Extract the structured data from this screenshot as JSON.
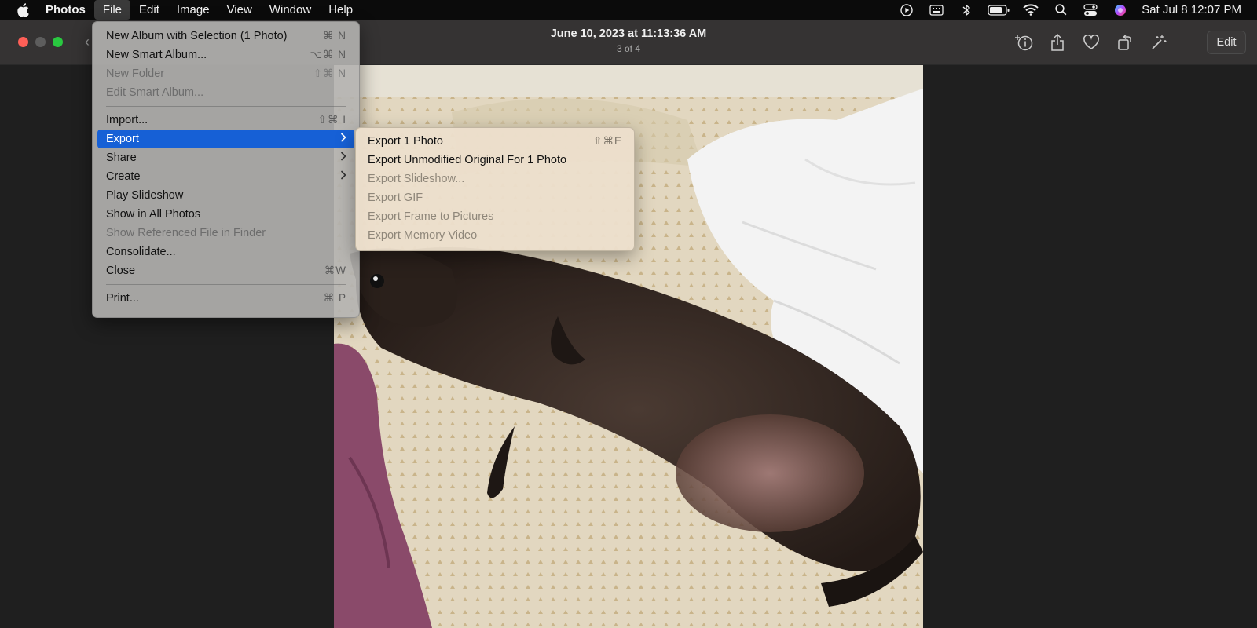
{
  "menubar": {
    "app_name": "Photos",
    "items": [
      "File",
      "Edit",
      "Image",
      "View",
      "Window",
      "Help"
    ],
    "clock": "Sat Jul 8  12:07 PM"
  },
  "toolbar": {
    "title": "June 10, 2023 at 11:13:36 AM",
    "subtitle": "3 of 4",
    "edit_label": "Edit"
  },
  "file_menu": {
    "items": [
      {
        "label": "New Album with Selection (1 Photo)",
        "shortcut": "⌘ N"
      },
      {
        "label": "New Smart Album...",
        "shortcut": "⌥⌘ N"
      },
      {
        "label": "New Folder",
        "shortcut": "⇧⌘ N"
      },
      {
        "label": "Edit Smart Album...",
        "shortcut": ""
      },
      {
        "label": "Import...",
        "shortcut": "⇧⌘ I"
      },
      {
        "label": "Export",
        "shortcut": ""
      },
      {
        "label": "Share",
        "shortcut": ""
      },
      {
        "label": "Create",
        "shortcut": ""
      },
      {
        "label": "Play Slideshow",
        "shortcut": ""
      },
      {
        "label": "Show in All Photos",
        "shortcut": ""
      },
      {
        "label": "Show Referenced File in Finder",
        "shortcut": ""
      },
      {
        "label": "Consolidate...",
        "shortcut": ""
      },
      {
        "label": "Close",
        "shortcut": "⌘W"
      },
      {
        "label": "Print...",
        "shortcut": "⌘ P"
      }
    ]
  },
  "export_submenu": {
    "items": [
      {
        "label": "Export 1 Photo",
        "shortcut": "⇧⌘E"
      },
      {
        "label": "Export Unmodified Original For 1 Photo",
        "shortcut": ""
      },
      {
        "label": "Export Slideshow...",
        "shortcut": ""
      },
      {
        "label": "Export GIF",
        "shortcut": ""
      },
      {
        "label": "Export Frame to Pictures",
        "shortcut": ""
      },
      {
        "label": "Export Memory Video",
        "shortcut": ""
      }
    ]
  },
  "colors": {
    "menubar_bg": "#0b0b0b",
    "toolbar_bg": "#353333",
    "highlight": "#1660d6",
    "traffic_red": "#fe5f57",
    "traffic_green": "#29c840"
  },
  "icons": [
    "apple-icon",
    "play-icon",
    "keyboard-icon",
    "bluetooth-icon",
    "battery-icon",
    "wifi-icon",
    "search-icon",
    "control-center-icon",
    "siri-icon",
    "info-icon",
    "share-icon",
    "heart-icon",
    "rotate-icon",
    "magic-wand-icon",
    "chevron-right-icon",
    "back-chevron-icon"
  ]
}
